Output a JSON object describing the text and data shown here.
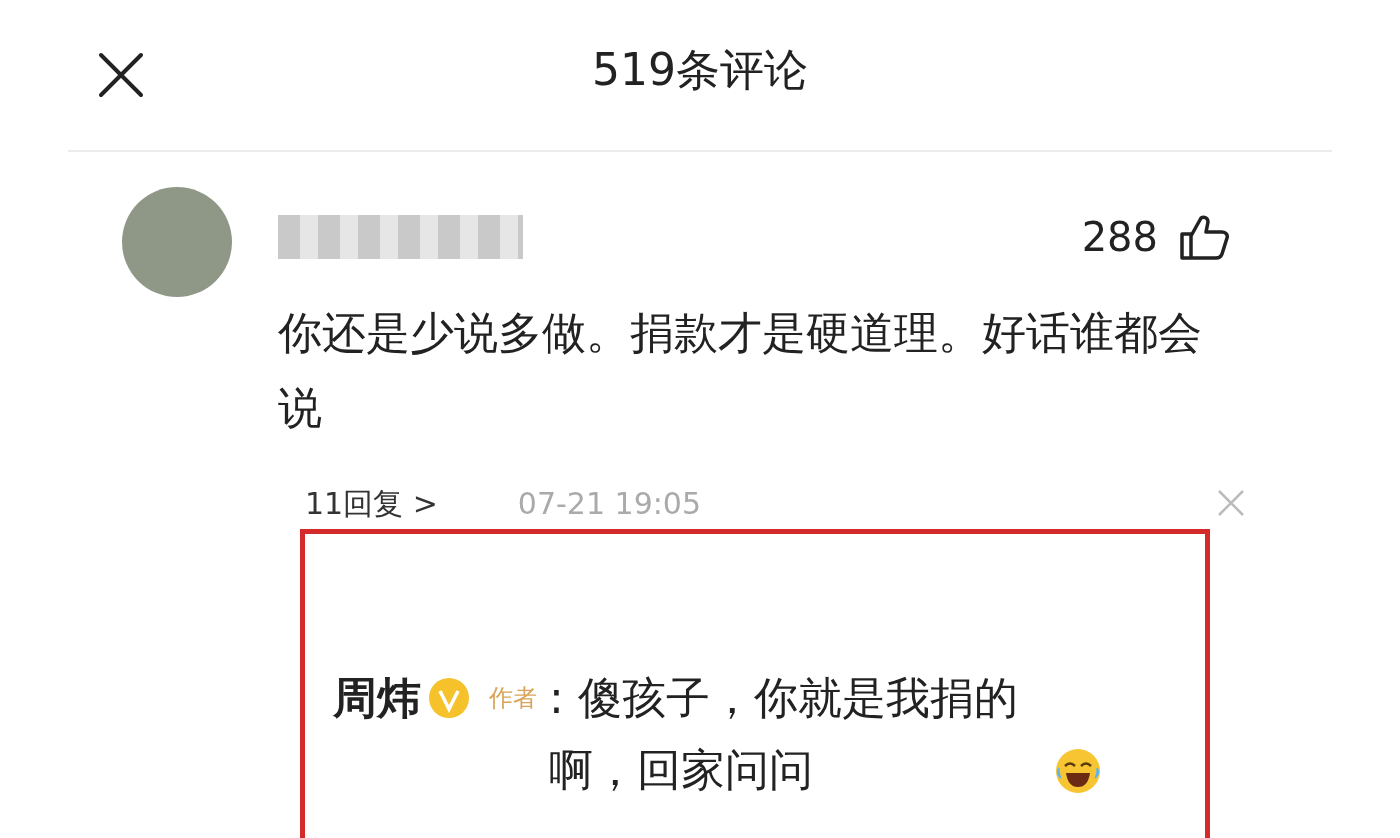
{
  "header": {
    "title": "519条评论"
  },
  "comment": {
    "likes": "288",
    "text": "你还是少说多做。捐款才是硬道理。好话谁都会说",
    "replies_link": "11回复 >",
    "time": "07-21 19:05"
  },
  "highlighted_reply": {
    "author": "周炜",
    "verified": true,
    "author_tag": "作者",
    "text": ": 傻孩子，你就是我捐的啊，回家问问"
  }
}
